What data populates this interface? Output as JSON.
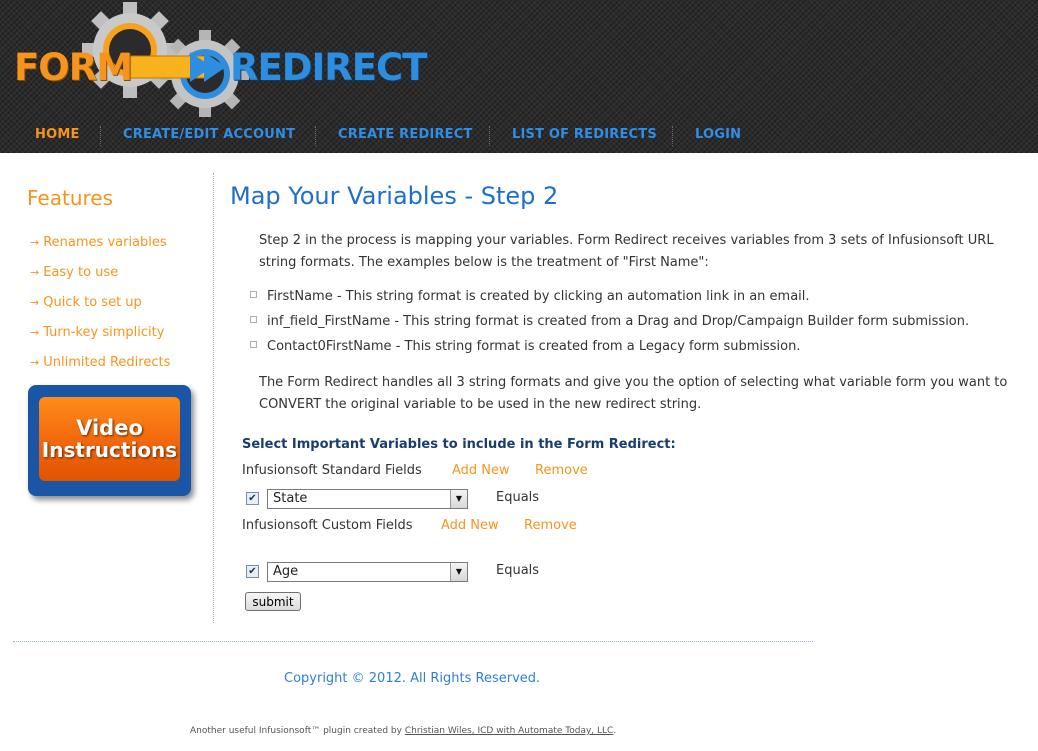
{
  "header": {
    "logo": {
      "form": "FORM",
      "redirect": "REDIRECT"
    },
    "nav": [
      {
        "label": "HOME",
        "active": true
      },
      {
        "label": "CREATE/EDIT ACCOUNT",
        "active": false
      },
      {
        "label": "CREATE REDIRECT",
        "active": false
      },
      {
        "label": "LIST OF REDIRECTS",
        "active": false
      },
      {
        "label": "LOGIN",
        "active": false
      }
    ]
  },
  "sidebar": {
    "title": "Features",
    "items": [
      "Renames variables",
      "Easy to use",
      "Quick to set up",
      "Turn-key simplicity",
      "Unlimited Redirects"
    ],
    "video_button": {
      "line1": "Video",
      "line2": "Instructions"
    }
  },
  "main": {
    "title": "Map Your Variables - Step 2",
    "intro": "Step 2 in the process is mapping your variables. Form Redirect receives variables from 3 sets of Infusionsoft URL string formats. The examples below is the treatment of \"First Name\":",
    "formats": [
      "FirstName - This string format is created by clicking an automation link in an email.",
      "inf_field_FirstName - This string format is created from a Drag and Drop/Campaign Builder form submission.",
      "Contact0FirstName - This string format is created from a Legacy form submission."
    ],
    "outro": "The Form Redirect handles all 3 string formats and give you the option of selecting what variable form you want to CONVERT the original variable to be used in the new redirect string.",
    "select_heading": "Select Important Variables to include in the Form Redirect:",
    "standard": {
      "label": "Infusionsoft Standard Fields",
      "add": "Add New",
      "remove": "Remove",
      "rows": [
        {
          "checked": true,
          "value": "State",
          "equals": "Equals"
        }
      ]
    },
    "custom": {
      "label": "Infusionsoft Custom Fields",
      "add": "Add New",
      "remove": "Remove",
      "rows": [
        {
          "checked": true,
          "value": "Age",
          "equals": "Equals"
        }
      ]
    },
    "submit_label": "submit"
  },
  "footer": {
    "copyright": "Copyright © 2012. All Rights Reserved.",
    "credit_prefix": "Another useful Infusionsoft™ plugin created by ",
    "credit_link": "Christian Wiles, ICD with Automate Today, LLC",
    "credit_suffix": "."
  },
  "colors": {
    "accent_orange": "#f7941d",
    "link_blue": "#2f8ee6",
    "title_blue": "#1e6fc9",
    "header_bg": "#2b2b2b"
  },
  "icons": [
    "gear-icon",
    "arrow-icon",
    "checkbox-icon",
    "dropdown-arrow-icon",
    "bullet-icon"
  ]
}
